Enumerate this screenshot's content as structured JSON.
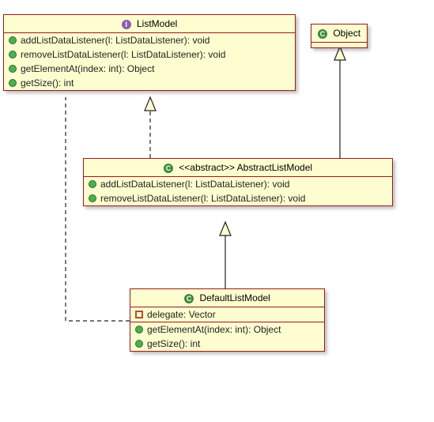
{
  "chart_data": {
    "type": "uml-class-diagram",
    "classes": [
      {
        "id": "ListModel",
        "kind": "interface",
        "name": "ListModel",
        "methods": [
          "addListDataListener(l: ListDataListener): void",
          "removeListDataListener(l: ListDataListener): void",
          "getElementAt(index: int): Object",
          "getSize(): int"
        ]
      },
      {
        "id": "Object",
        "kind": "class",
        "name": "Object"
      },
      {
        "id": "AbstractListModel",
        "kind": "class",
        "stereotype": "<<abstract>>",
        "name": "AbstractListModel",
        "methods": [
          "addListDataListener(l: ListDataListener): void",
          "removeListDataListener(l: ListDataListener): void"
        ]
      },
      {
        "id": "DefaultListModel",
        "kind": "class",
        "name": "DefaultListModel",
        "fields": [
          {
            "vis": "private",
            "sig": "delegate: Vector"
          }
        ],
        "methods": [
          "getElementAt(index: int): Object",
          "getSize(): int"
        ]
      }
    ],
    "relationships": [
      {
        "from": "AbstractListModel",
        "to": "ListModel",
        "type": "realization"
      },
      {
        "from": "AbstractListModel",
        "to": "Object",
        "type": "generalization"
      },
      {
        "from": "DefaultListModel",
        "to": "AbstractListModel",
        "type": "generalization"
      },
      {
        "from": "DefaultListModel",
        "to": "ListModel",
        "type": "dependency"
      }
    ]
  },
  "listModel": {
    "name": "ListModel",
    "m0": "addListDataListener(l: ListDataListener): void",
    "m1": "removeListDataListener(l: ListDataListener): void",
    "m2": "getElementAt(index: int): Object",
    "m3": "getSize(): int"
  },
  "object": {
    "name": "Object"
  },
  "abstractListModel": {
    "stereo": "<<abstract>>",
    "name": "AbstractListModel",
    "m0": "addListDataListener(l: ListDataListener): void",
    "m1": "removeListDataListener(l: ListDataListener): void"
  },
  "defaultListModel": {
    "name": "DefaultListModel",
    "f0": "delegate: Vector",
    "m0": "getElementAt(index: int): Object",
    "m1": "getSize(): int"
  }
}
